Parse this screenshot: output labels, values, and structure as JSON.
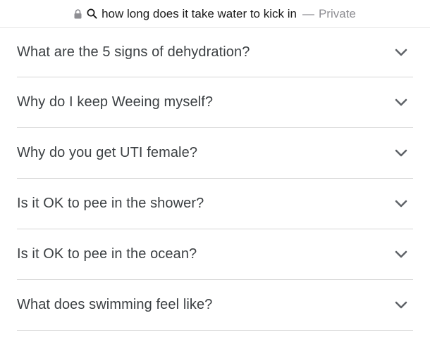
{
  "address_bar": {
    "query": "how long does it take water to kick in",
    "separator": "—",
    "mode": "Private",
    "lock_icon": "lock-icon",
    "search_icon": "search-icon"
  },
  "faq": {
    "items": [
      {
        "question": "What are the 5 signs of dehydration?",
        "icon": "chevron-down-icon"
      },
      {
        "question": "Why do I keep Weeing myself?",
        "icon": "chevron-down-icon"
      },
      {
        "question": "Why do you get UTI female?",
        "icon": "chevron-down-icon"
      },
      {
        "question": "Is it OK to pee in the shower?",
        "icon": "chevron-down-icon"
      },
      {
        "question": "Is it OK to pee in the ocean?",
        "icon": "chevron-down-icon"
      },
      {
        "question": "What does swimming feel like?",
        "icon": "chevron-down-icon"
      }
    ]
  },
  "colors": {
    "text": "#3c4043",
    "muted": "#8e8e93",
    "divider": "#d5d5d5"
  }
}
